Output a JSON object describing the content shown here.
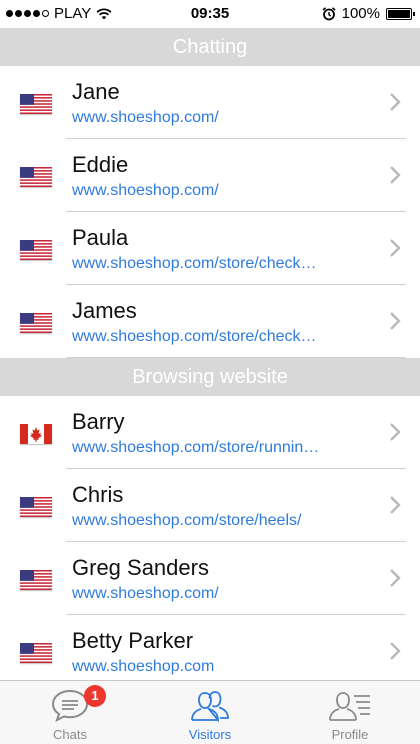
{
  "status_bar": {
    "carrier": "PLAY",
    "time": "09:35",
    "battery": "100%",
    "battery_level": 1.0,
    "signal_bars_filled": 4,
    "signal_bars_total": 5
  },
  "sections": {
    "chatting": "Chatting",
    "browsing": "Browsing website"
  },
  "chatting": [
    {
      "name": "Jane",
      "url": "www.shoeshop.com/",
      "flag": "us"
    },
    {
      "name": "Eddie",
      "url": "www.shoeshop.com/",
      "flag": "us"
    },
    {
      "name": "Paula",
      "url": "www.shoeshop.com/store/check…",
      "flag": "us"
    },
    {
      "name": "James",
      "url": "www.shoeshop.com/store/check…",
      "flag": "us"
    }
  ],
  "browsing": [
    {
      "name": "Barry",
      "url": "www.shoeshop.com/store/runnin…",
      "flag": "ca"
    },
    {
      "name": "Chris",
      "url": "www.shoeshop.com/store/heels/",
      "flag": "us"
    },
    {
      "name": "Greg Sanders",
      "url": "www.shoeshop.com/",
      "flag": "us"
    },
    {
      "name": "Betty Parker",
      "url": "www.shoeshop.com",
      "flag": "us"
    }
  ],
  "tabs": {
    "chats": "Chats",
    "chats_badge": "1",
    "visitors": "Visitors",
    "profile": "Profile"
  },
  "colors": {
    "accent": "#2f7bdc",
    "badge": "#f0362c",
    "section_bg": "#d8d8d8"
  }
}
